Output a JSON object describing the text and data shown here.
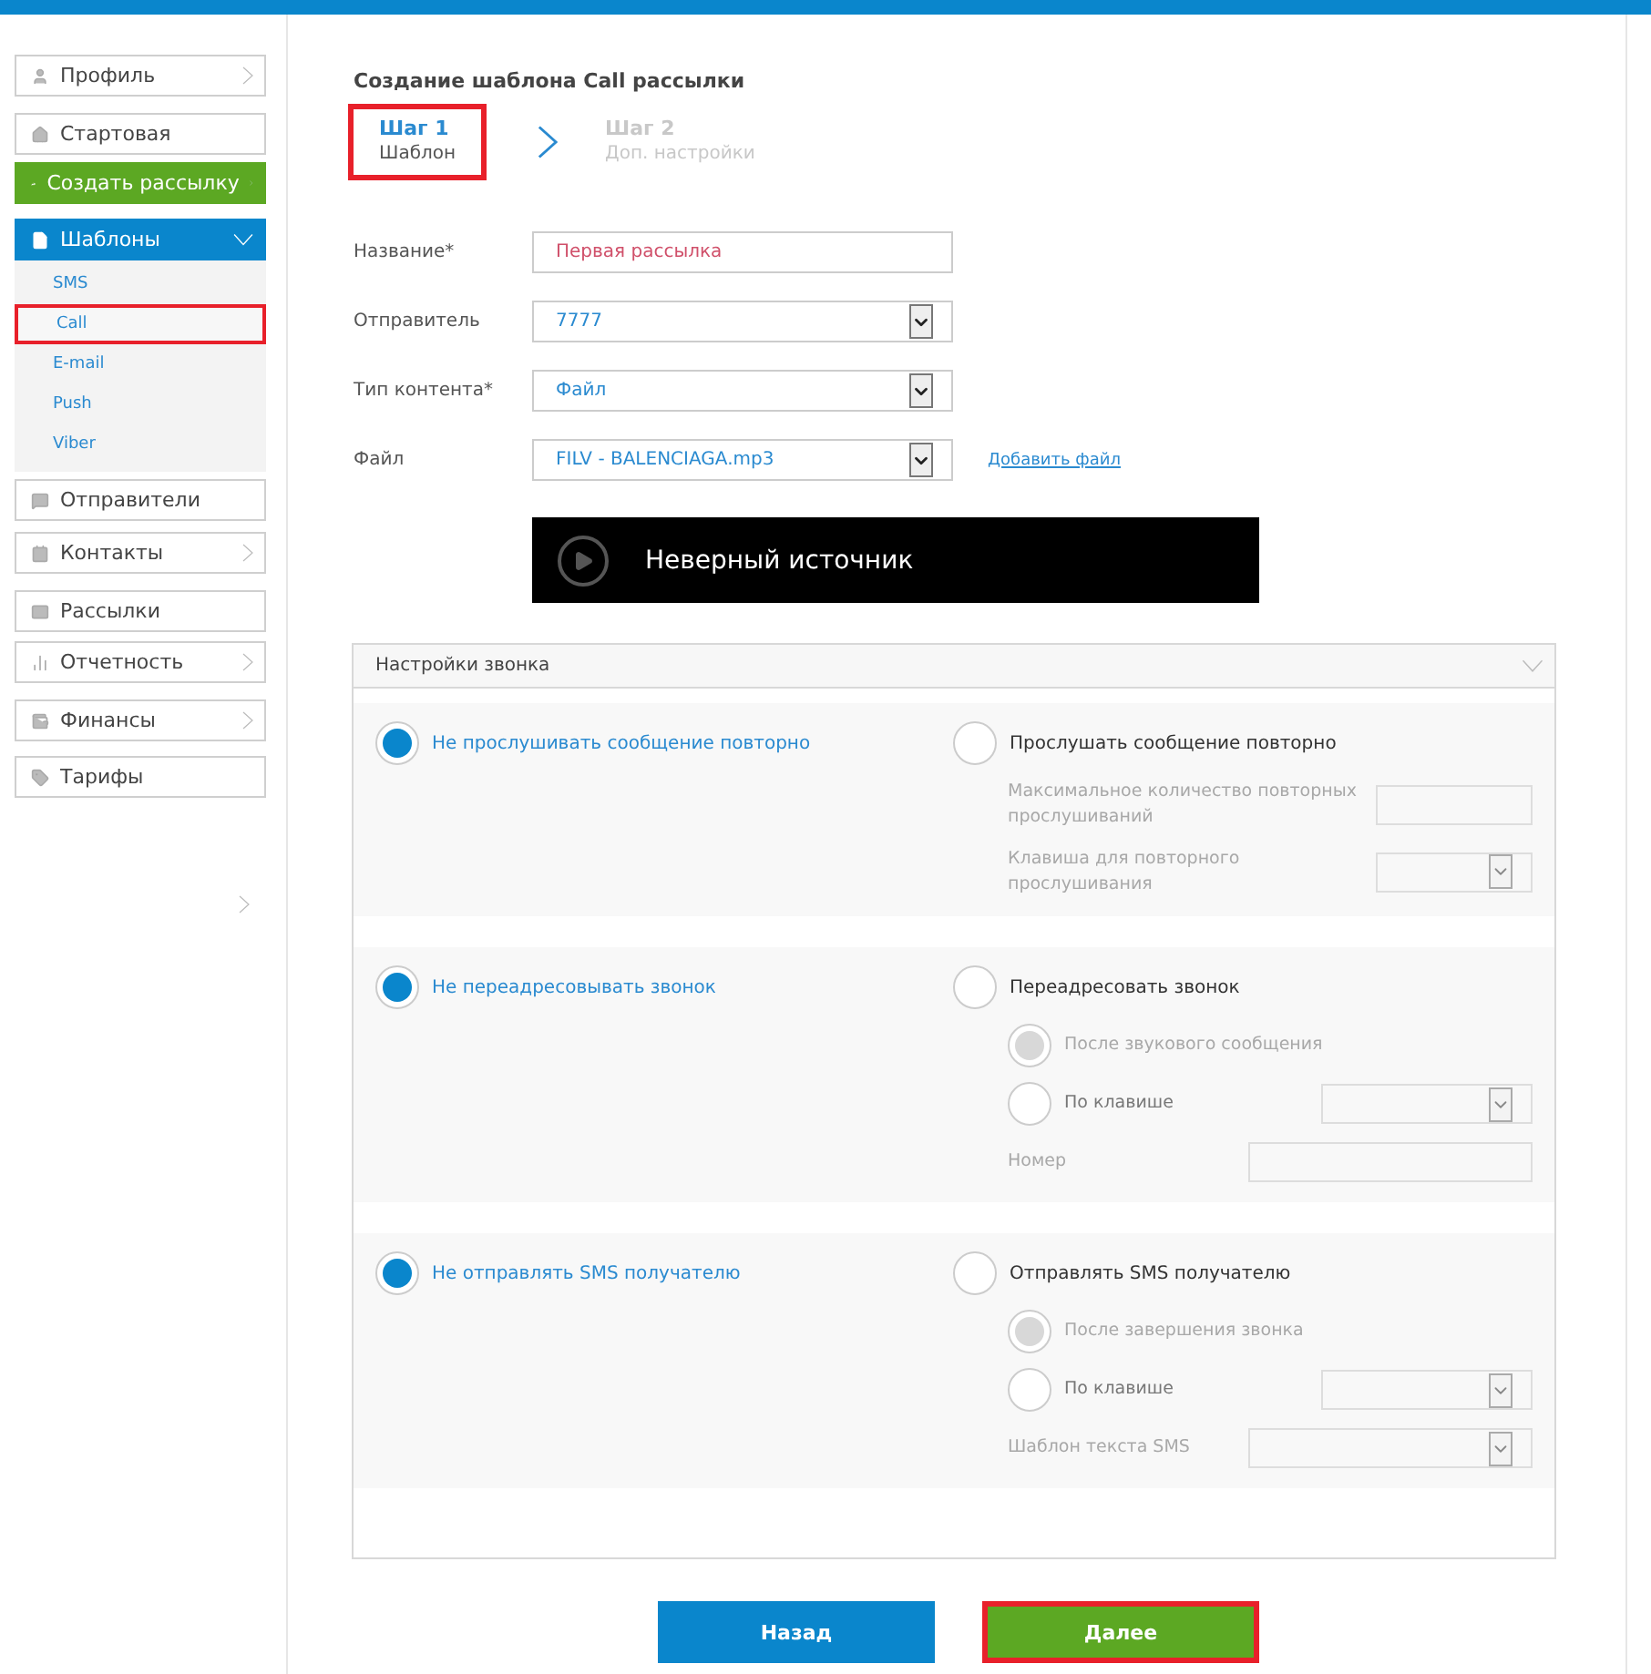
{
  "sidebar": {
    "items": [
      {
        "label": "Профиль",
        "kind": "plain",
        "chevron": true
      },
      {
        "label": "Стартовая",
        "kind": "plain",
        "chevron": false
      },
      {
        "label": "Создать рассылку",
        "kind": "action",
        "chevron": true
      },
      {
        "label": "Шаблоны",
        "kind": "group",
        "expanded": true,
        "children": [
          {
            "label": "SMS",
            "selected": false
          },
          {
            "label": "Call",
            "selected": true
          },
          {
            "label": "E-mail",
            "selected": false
          },
          {
            "label": "Push",
            "selected": false
          },
          {
            "label": "Viber",
            "selected": false
          }
        ]
      },
      {
        "label": "Отправители",
        "kind": "plain",
        "chevron": false
      },
      {
        "label": "Контакты",
        "kind": "plain",
        "chevron": true
      },
      {
        "label": "Рассылки",
        "kind": "plain",
        "chevron": false
      },
      {
        "label": "Отчетность",
        "kind": "plain",
        "chevron": true
      },
      {
        "label": "Финансы",
        "kind": "plain",
        "chevron": true
      },
      {
        "label": "Тарифы",
        "kind": "plain",
        "chevron": false
      }
    ]
  },
  "title": "Создание шаблона Call рассылки",
  "steps": [
    {
      "title": "Шаг 1",
      "subtitle": "Шаблон",
      "selected": true
    },
    {
      "title": "Шаг 2",
      "subtitle": "Доп. настройки",
      "selected": false
    }
  ],
  "form": [
    {
      "label": "Название*",
      "kind": "input",
      "value": "Первая рассылка"
    },
    {
      "label": "Отправитель",
      "kind": "select",
      "value": "7777"
    },
    {
      "label": "Тип контента*",
      "kind": "select",
      "value": "Файл"
    },
    {
      "label": "Файл",
      "kind": "select",
      "value": "FILV - BALENCIAGA.mp3",
      "link": "Добавить файл"
    }
  ],
  "player": {
    "message": "Неверный источник"
  },
  "settings": {
    "title": "Настройки звонка",
    "expanded": true,
    "sections": [
      {
        "options": [
          {
            "label": "Не прослушивать сообщение повторно",
            "selected": true
          },
          {
            "label": "Прослушать сообщение повторно",
            "selected": false
          }
        ],
        "sub": [
          {
            "kind": "input",
            "label": "Максимальное количество повторных прослушиваний",
            "disabled": true
          },
          {
            "kind": "select",
            "label": "Клавиша для повторного прослушивания",
            "disabled": true
          }
        ]
      },
      {
        "options": [
          {
            "label": "Не переадресовывать звонок",
            "selected": true
          },
          {
            "label": "Переадресовать звонок",
            "selected": false
          }
        ],
        "sub": [
          {
            "kind": "radio",
            "label": "После звукового сообщения",
            "selected": true,
            "disabled": true
          },
          {
            "kind": "radio-select",
            "label": "По клавише",
            "selected": false,
            "disabled": false
          },
          {
            "kind": "wide-input",
            "label": "Номер",
            "disabled": true
          }
        ]
      },
      {
        "options": [
          {
            "label": "Не отправлять SMS получателю",
            "selected": true
          },
          {
            "label": "Отправлять SMS получателю",
            "selected": false
          }
        ],
        "sub": [
          {
            "kind": "radio",
            "label": "После завершения звонка",
            "selected": true,
            "disabled": true
          },
          {
            "kind": "radio-select",
            "label": "По клавише",
            "selected": false,
            "disabled": false
          },
          {
            "kind": "wide-select",
            "label": "Шаблон текста SMS",
            "disabled": true
          }
        ]
      }
    ]
  },
  "buttons": [
    {
      "label": "Назад",
      "kind": "secondary",
      "highlighted": false
    },
    {
      "label": "Далее",
      "kind": "primary",
      "highlighted": true
    }
  ]
}
